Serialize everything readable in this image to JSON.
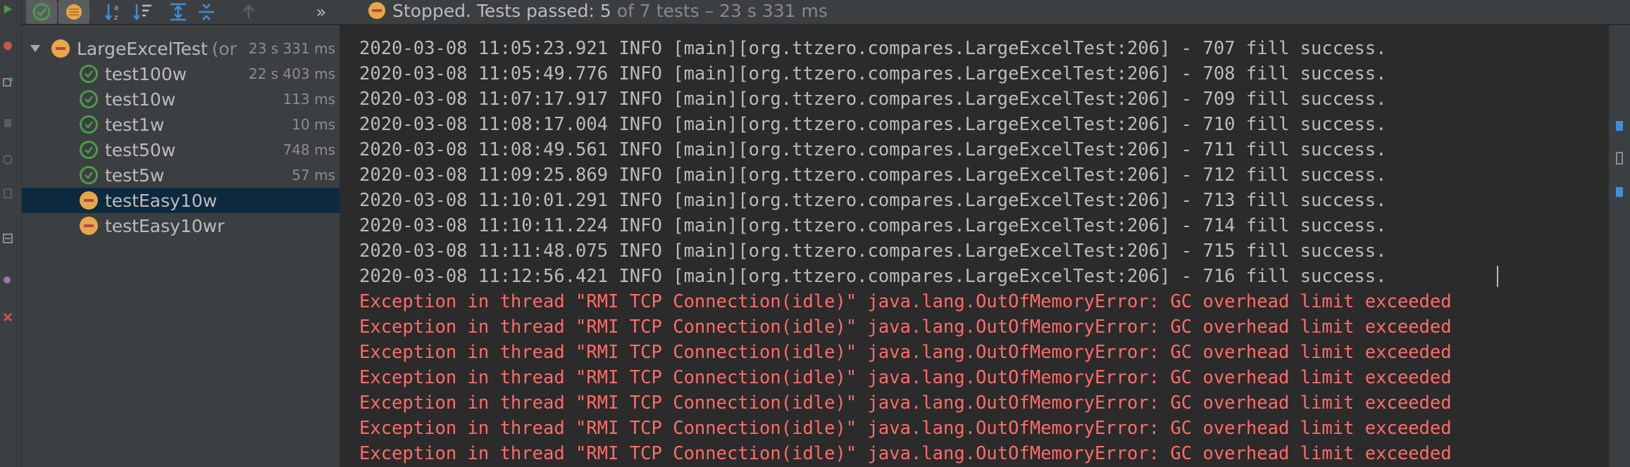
{
  "toolbar": {
    "status": "Stopped.",
    "summary_prefix": "Tests passed: 5",
    "summary_suffix": "of 7 tests – 23 s 331 ms",
    "more_label": "»"
  },
  "tree": {
    "root": {
      "name": "LargeExcelTest",
      "suffix": "(or",
      "duration": "23 s 331 ms",
      "state": "stopped"
    },
    "tests": [
      {
        "name": "test100w",
        "duration": "22 s 403 ms",
        "state": "passed"
      },
      {
        "name": "test10w",
        "duration": "113 ms",
        "state": "passed"
      },
      {
        "name": "test1w",
        "duration": "10 ms",
        "state": "passed"
      },
      {
        "name": "test50w",
        "duration": "748 ms",
        "state": "passed"
      },
      {
        "name": "test5w",
        "duration": "57 ms",
        "state": "passed"
      },
      {
        "name": "testEasy10w",
        "duration": "",
        "state": "stopped",
        "selected": true
      },
      {
        "name": "testEasy10wr",
        "duration": "",
        "state": "stopped"
      }
    ]
  },
  "console": {
    "lines": [
      {
        "text": "2020-03-08 11:05:23.921 INFO [main][org.ttzero.compares.LargeExcelTest:206] - 707 fill success.",
        "type": "info"
      },
      {
        "text": "2020-03-08 11:05:49.776 INFO [main][org.ttzero.compares.LargeExcelTest:206] - 708 fill success.",
        "type": "info"
      },
      {
        "text": "2020-03-08 11:07:17.917 INFO [main][org.ttzero.compares.LargeExcelTest:206] - 709 fill success.",
        "type": "info"
      },
      {
        "text": "2020-03-08 11:08:17.004 INFO [main][org.ttzero.compares.LargeExcelTest:206] - 710 fill success.",
        "type": "info"
      },
      {
        "text": "2020-03-08 11:08:49.561 INFO [main][org.ttzero.compares.LargeExcelTest:206] - 711 fill success.",
        "type": "info"
      },
      {
        "text": "2020-03-08 11:09:25.869 INFO [main][org.ttzero.compares.LargeExcelTest:206] - 712 fill success.",
        "type": "info"
      },
      {
        "text": "2020-03-08 11:10:01.291 INFO [main][org.ttzero.compares.LargeExcelTest:206] - 713 fill success.",
        "type": "info"
      },
      {
        "text": "2020-03-08 11:10:11.224 INFO [main][org.ttzero.compares.LargeExcelTest:206] - 714 fill success.",
        "type": "info"
      },
      {
        "text": "2020-03-08 11:11:48.075 INFO [main][org.ttzero.compares.LargeExcelTest:206] - 715 fill success.",
        "type": "info"
      },
      {
        "text": "2020-03-08 11:12:56.421 INFO [main][org.ttzero.compares.LargeExcelTest:206] - 716 fill success.",
        "type": "info"
      },
      {
        "text": "Exception in thread \"RMI TCP Connection(idle)\" java.lang.OutOfMemoryError: GC overhead limit exceeded",
        "type": "error"
      },
      {
        "text": "Exception in thread \"RMI TCP Connection(idle)\" java.lang.OutOfMemoryError: GC overhead limit exceeded",
        "type": "error"
      },
      {
        "text": "Exception in thread \"RMI TCP Connection(idle)\" java.lang.OutOfMemoryError: GC overhead limit exceeded",
        "type": "error"
      },
      {
        "text": "Exception in thread \"RMI TCP Connection(idle)\" java.lang.OutOfMemoryError: GC overhead limit exceeded",
        "type": "error"
      },
      {
        "text": "Exception in thread \"RMI TCP Connection(idle)\" java.lang.OutOfMemoryError: GC overhead limit exceeded",
        "type": "error"
      },
      {
        "text": "Exception in thread \"RMI TCP Connection(idle)\" java.lang.OutOfMemoryError: GC overhead limit exceeded",
        "type": "error"
      },
      {
        "text": "Exception in thread \"RMI TCP Connection(idle)\" java.lang.OutOfMemoryError: GC overhead limit exceeded",
        "type": "error"
      }
    ]
  },
  "colors": {
    "background": "#2b2b2b",
    "panel": "#3c3f41",
    "text": "#bbbbbb",
    "error_text": "#ff6b68",
    "pass": "#4c9a4c",
    "stopped": "#e8a64a",
    "selection": "#0d293e"
  },
  "icons": {
    "gutter": [
      "run-icon",
      "stop-icon",
      "rerun-failed-icon",
      "debug-icon",
      "pause-icon",
      "dump-threads-icon",
      "settings-icon",
      "pin-icon",
      "close-icon"
    ],
    "toolbar": [
      "show-passed-icon",
      "show-ignored-icon",
      "sort-alpha-icon",
      "sort-duration-icon",
      "expand-all-icon",
      "collapse-all-icon",
      "previous-failed-icon"
    ]
  }
}
